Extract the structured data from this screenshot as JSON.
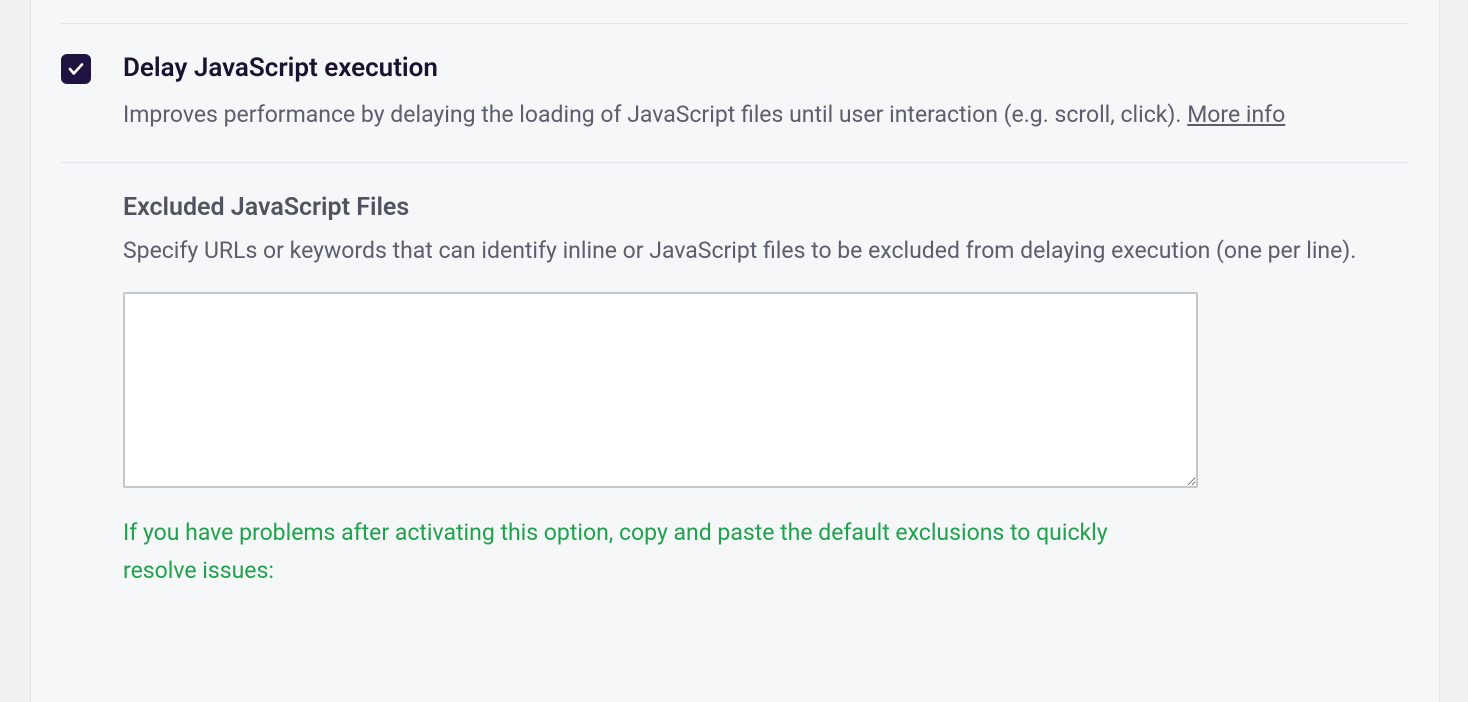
{
  "delayJs": {
    "checked": true,
    "title": "Delay JavaScript execution",
    "description_pre": "Improves performance by delaying the loading of JavaScript files until user interaction (e.g. scroll, click). ",
    "more_info": "More info"
  },
  "excluded": {
    "title": "Excluded JavaScript Files",
    "description": "Specify URLs or keywords that can identify inline or JavaScript files to be excluded from delaying execution (one per line).",
    "textarea_value": "",
    "hint": "If you have problems after activating this option, copy and paste the default exclusions to quickly resolve issues:"
  }
}
